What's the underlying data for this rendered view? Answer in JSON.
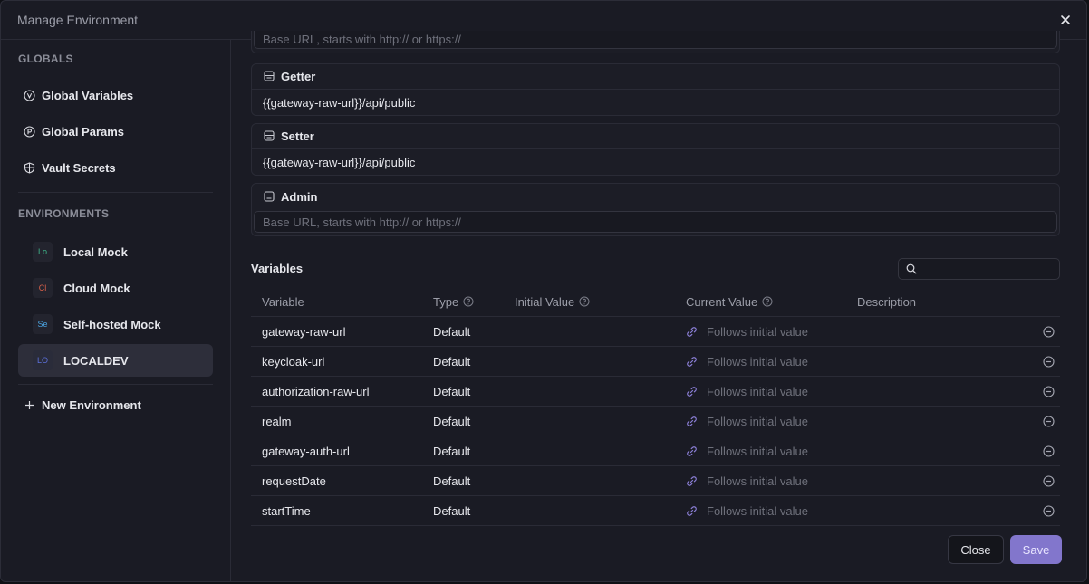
{
  "window": {
    "title": "Manage Environment",
    "close_icon": "close-icon"
  },
  "sidebar": {
    "globals_title": "GLOBALS",
    "globals": [
      {
        "label": "Global Variables",
        "icon": "variable-icon"
      },
      {
        "label": "Global Params",
        "icon": "param-icon"
      },
      {
        "label": "Vault Secrets",
        "icon": "shield-icon"
      }
    ],
    "environments_title": "ENVIRONMENTS",
    "environments": [
      {
        "badge": "Lo",
        "label": "Local Mock",
        "color": "#3fb58a",
        "active": false
      },
      {
        "badge": "Cl",
        "label": "Cloud Mock",
        "color": "#d9604a",
        "active": false
      },
      {
        "badge": "Se",
        "label": "Self-hosted Mock",
        "color": "#4aa3e0",
        "active": false
      },
      {
        "badge": "LO",
        "label": "LOCALDEV",
        "color": "#5b6fd9",
        "active": true
      }
    ],
    "new_environment": "New Environment"
  },
  "services": {
    "top_placeholder": "Base URL, starts with http:// or https://",
    "cards": [
      {
        "name": "Getter",
        "value": "{{gateway-raw-url}}/api/public",
        "placeholder": ""
      },
      {
        "name": "Setter",
        "value": "{{gateway-raw-url}}/api/public",
        "placeholder": ""
      },
      {
        "name": "Admin",
        "value": "",
        "placeholder": "Base URL, starts with http:// or https://"
      }
    ]
  },
  "variables": {
    "title": "Variables",
    "search_placeholder": "",
    "columns": {
      "variable": "Variable",
      "type": "Type",
      "initial": "Initial Value",
      "current": "Current Value",
      "description": "Description"
    },
    "rows": [
      {
        "name": "gateway-raw-url",
        "type": "Default",
        "initial": "",
        "current": "Follows initial value",
        "description": ""
      },
      {
        "name": "keycloak-url",
        "type": "Default",
        "initial": "",
        "current": "Follows initial value",
        "description": ""
      },
      {
        "name": "authorization-raw-url",
        "type": "Default",
        "initial": "",
        "current": "Follows initial value",
        "description": ""
      },
      {
        "name": "realm",
        "type": "Default",
        "initial": "",
        "current": "Follows initial value",
        "description": ""
      },
      {
        "name": "gateway-auth-url",
        "type": "Default",
        "initial": "",
        "current": "Follows initial value",
        "description": ""
      },
      {
        "name": "requestDate",
        "type": "Default",
        "initial": "",
        "current": "Follows initial value",
        "description": ""
      },
      {
        "name": "startTime",
        "type": "Default",
        "initial": "",
        "current": "Follows initial value",
        "description": ""
      }
    ]
  },
  "footer": {
    "close_label": "Close",
    "save_label": "Save"
  },
  "colors": {
    "accent": "#8276cc",
    "background": "#1a1b24",
    "border": "#2a2b36"
  }
}
